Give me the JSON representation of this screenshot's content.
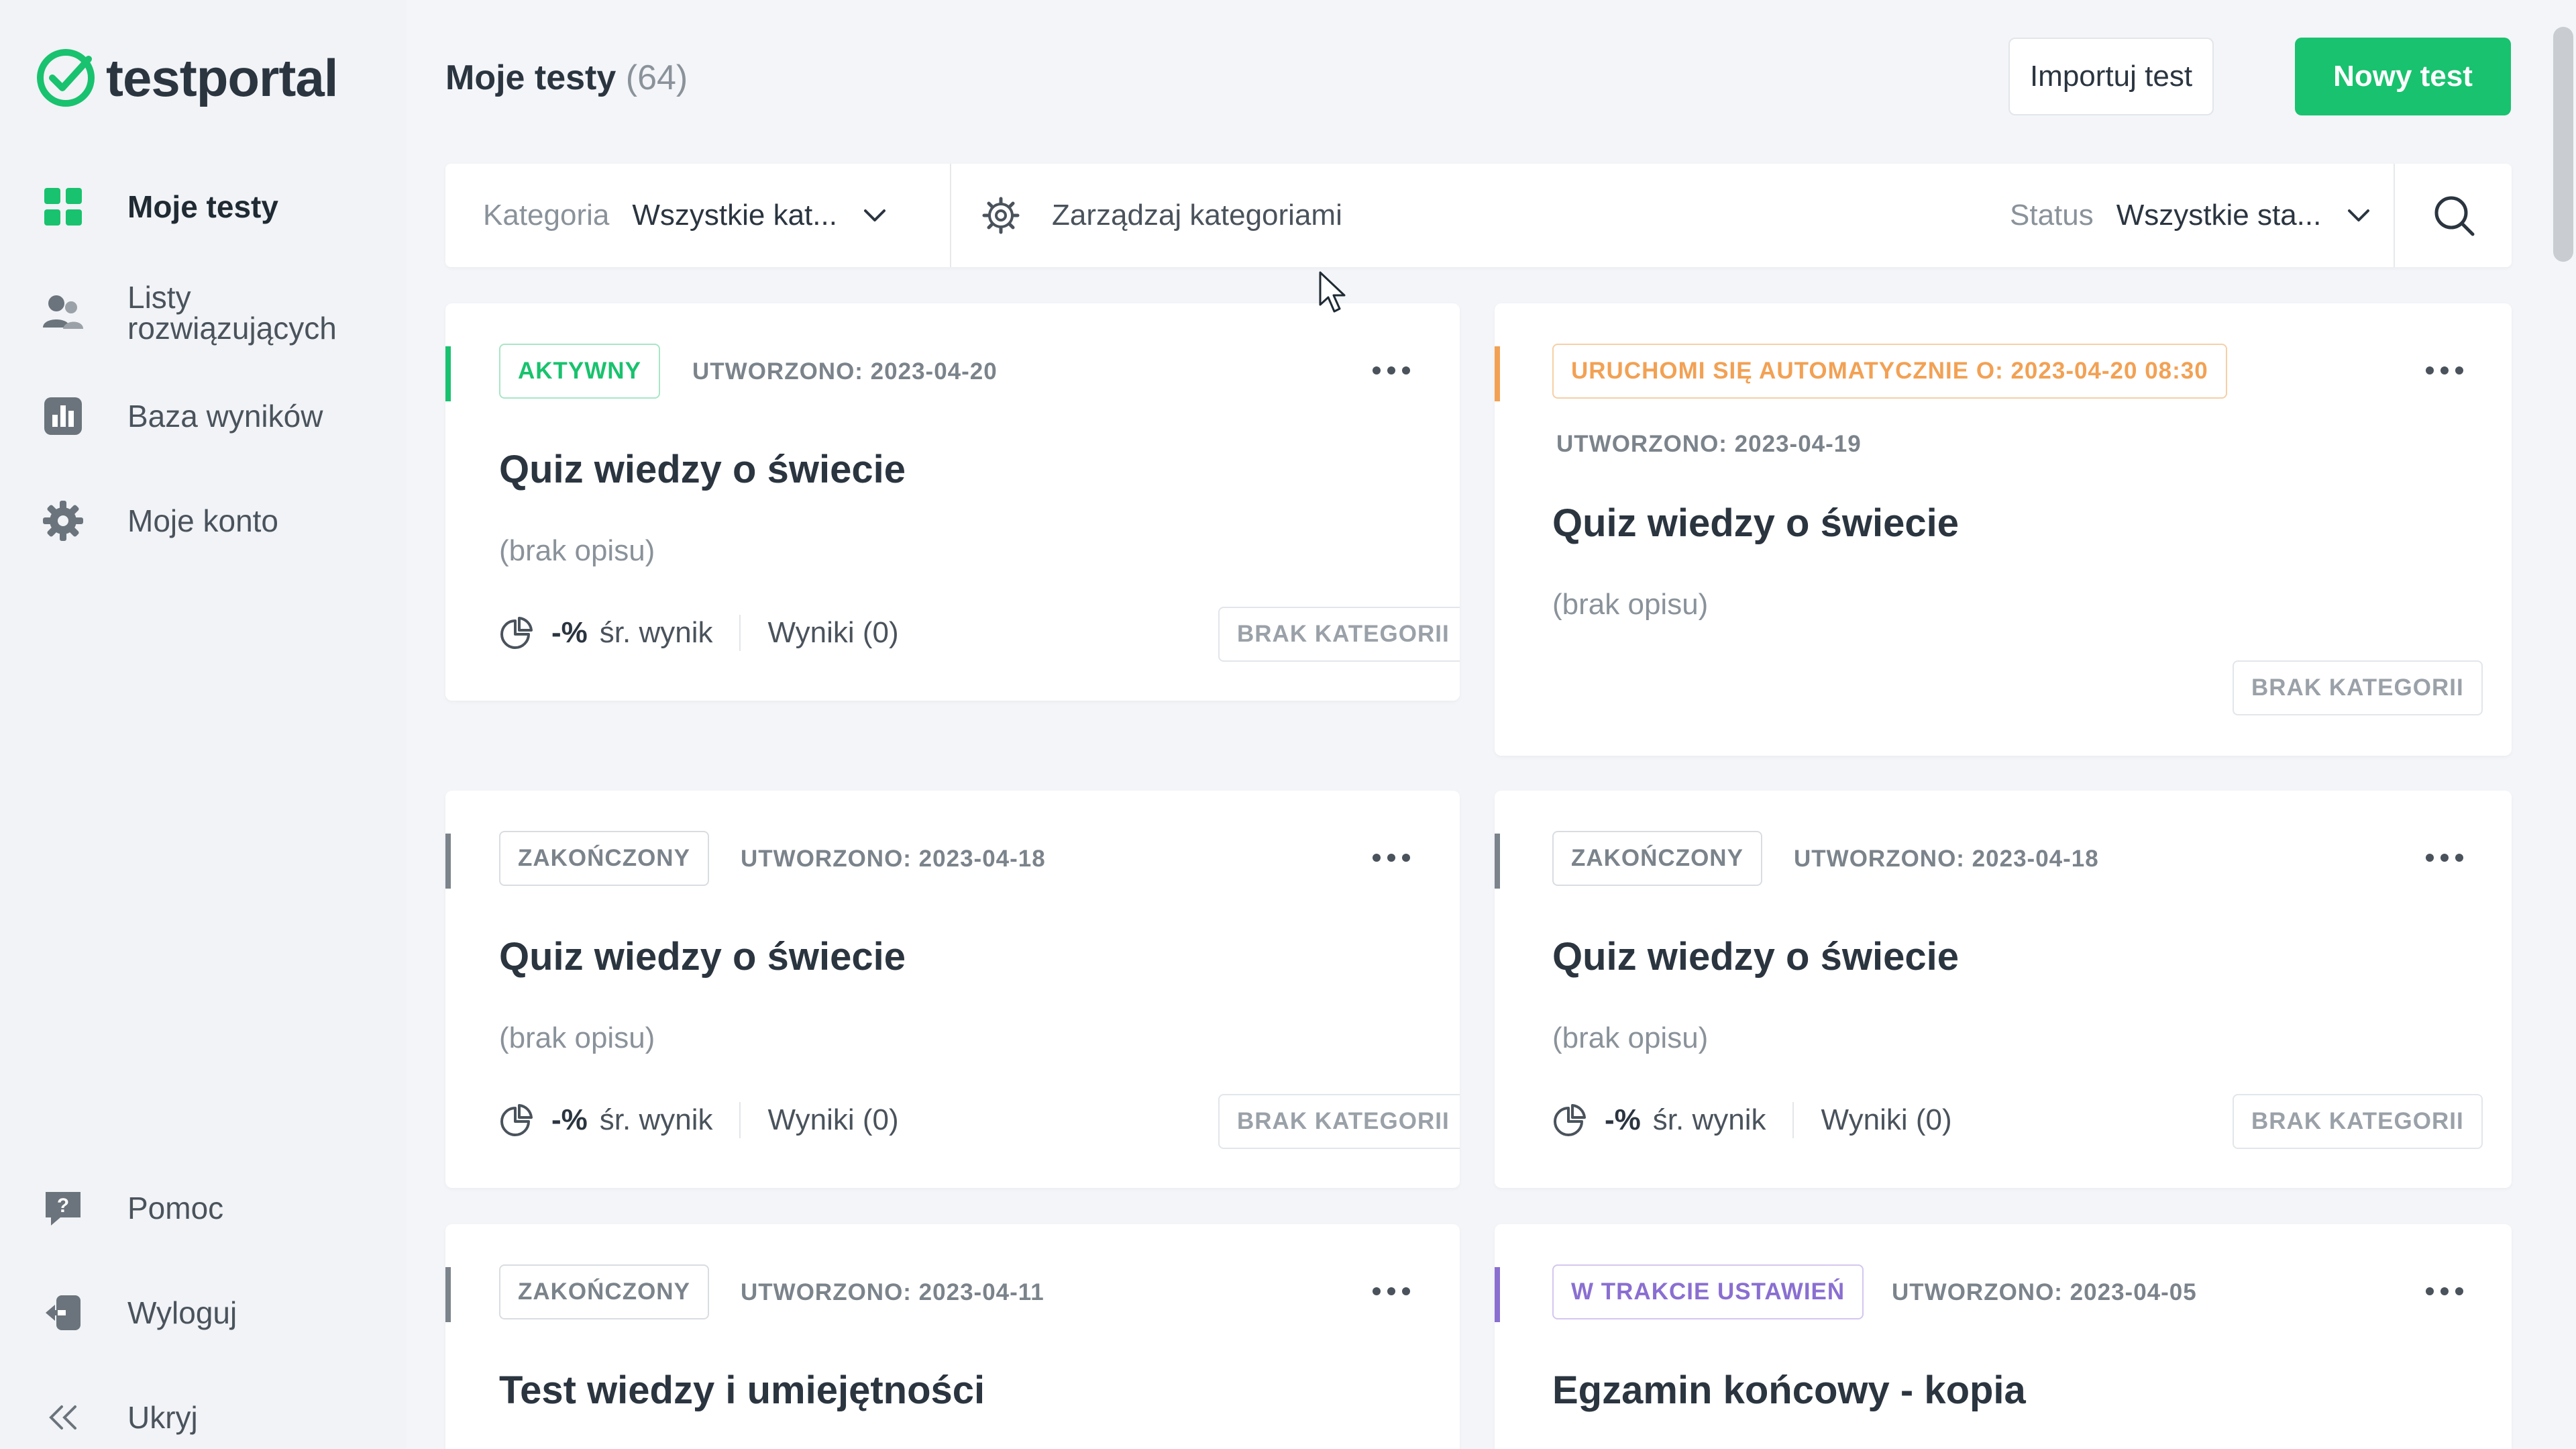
{
  "brand": {
    "name": "testportal",
    "color": "#19c26e"
  },
  "sidebar": {
    "items": [
      {
        "label": "Moje testy",
        "icon": "grid-icon",
        "active": true
      },
      {
        "label": "Listy rozwiązujących",
        "icon": "users-icon"
      },
      {
        "label": "Baza wyników",
        "icon": "chart-icon"
      },
      {
        "label": "Moje konto",
        "icon": "gear-icon"
      }
    ],
    "bottom": [
      {
        "label": "Pomoc",
        "icon": "help-icon"
      },
      {
        "label": "Wyloguj",
        "icon": "logout-icon"
      },
      {
        "label": "Ukryj",
        "icon": "double-chevron-left-icon"
      }
    ]
  },
  "header": {
    "title": "Moje testy",
    "count": "(64)",
    "import_label": "Importuj test",
    "new_label": "Nowy test"
  },
  "filters": {
    "category_label": "Kategoria",
    "category_value": "Wszystkie kat...",
    "manage_label": "Zarządzaj kategoriami",
    "status_label": "Status",
    "status_value": "Wszystkie sta..."
  },
  "colors": {
    "active": "#19c26e",
    "scheduled": "#f2a154",
    "finished": "#7b838b",
    "draft": "#8a6fd1"
  },
  "cards": [
    {
      "status": "AKTYWNY",
      "created": "UTWORZONO: 2023-04-20",
      "title": "Quiz wiedzy o świecie",
      "description": "(brak opisu)",
      "score": "-%",
      "score_label": "śr. wynik",
      "results": "Wyniki (0)",
      "category": "BRAK KATEGORII"
    },
    {
      "status": "URUCHOMI SIĘ AUTOMATYCZNIE O: 2023-04-20 08:30",
      "created": "UTWORZONO: 2023-04-19",
      "title": "Quiz wiedzy o świecie",
      "description": "(brak opisu)",
      "category": "BRAK KATEGORII"
    },
    {
      "status": "ZAKOŃCZONY",
      "created": "UTWORZONO: 2023-04-18",
      "title": "Quiz wiedzy o świecie",
      "description": "(brak opisu)",
      "score": "-%",
      "score_label": "śr. wynik",
      "results": "Wyniki (0)",
      "category": "BRAK KATEGORII"
    },
    {
      "status": "ZAKOŃCZONY",
      "created": "UTWORZONO: 2023-04-18",
      "title": "Quiz wiedzy o świecie",
      "description": "(brak opisu)",
      "score": "-%",
      "score_label": "śr. wynik",
      "results": "Wyniki (0)",
      "category": "BRAK KATEGORII"
    },
    {
      "status": "ZAKOŃCZONY",
      "created": "UTWORZONO: 2023-04-11",
      "title": "Test wiedzy i umiejętności"
    },
    {
      "status": "W TRAKCIE USTAWIEŃ",
      "created": "UTWORZONO: 2023-04-05",
      "title": "Egzamin końcowy - kopia"
    }
  ]
}
